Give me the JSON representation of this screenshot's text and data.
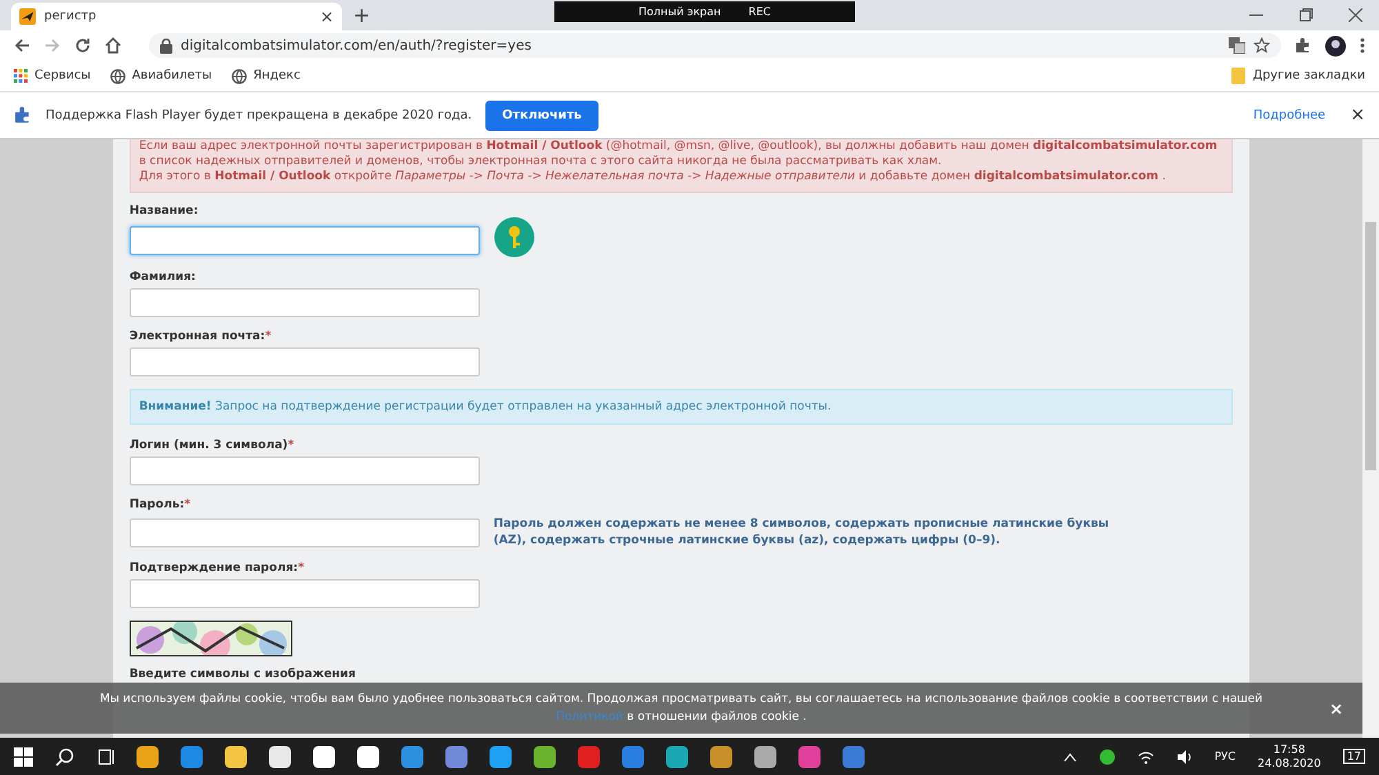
{
  "browser": {
    "tab": {
      "title": "регистр",
      "close": "×"
    },
    "new_tab": "+",
    "url": "digitalcombatsimulator.com/en/auth/?register=yes",
    "bookmarks": [
      {
        "label": "Сервисы",
        "kind": "apps"
      },
      {
        "label": "Авиабилеты",
        "kind": "globe"
      },
      {
        "label": "Яндекс",
        "kind": "globe"
      }
    ],
    "other_bookmarks": "Другие закладки"
  },
  "recorder": {
    "label": "Полный экран",
    "rec": "REC"
  },
  "infobar": {
    "text": "Поддержка Flash Player будет прекращена в декабре 2020 года.",
    "button": "Отключить",
    "link": "Подробнее",
    "close": "×"
  },
  "alert": {
    "lines": [
      "Если ваш адрес электронной почты зарегистрирован в **Hotmail / Outlook** (@hotmail, @msn, @live, @outlook), вы должны добавить наш домен **digitalcombatsimulator.com** в список надежных отправителей и доменов, чтобы электронная почта с этого сайта никогда не была рассматривать как хлам.",
      "Для этого в **Hotmail / Outlook** откройте *Параметры -> Почта -> Нежелательная почта -> Надежные отправители* и добавьте домен **digitalcombatsimulator.com** ."
    ]
  },
  "form": [
    {
      "kind": "field",
      "label": "Название:",
      "required": false,
      "focused": true,
      "hint_key": true
    },
    {
      "kind": "field",
      "label": "Фамилия:",
      "required": false,
      "focused": false
    },
    {
      "kind": "field",
      "label": "Электронная почта:",
      "required": true,
      "focused": false
    },
    {
      "kind": "notice",
      "text": "**Внимание!** Запрос на подтверждение регистрации будет отправлен на указанный адрес электронной почты."
    },
    {
      "kind": "field",
      "label": "Логин (мин. 3 символа)",
      "required": true,
      "focused": false
    },
    {
      "kind": "field",
      "label": "Пароль:",
      "required": true,
      "focused": false,
      "help": "Пароль должен содержать не менее 8 символов, содержать прописные латинские буквы (AZ), содержать строчные латинские буквы (az), содержать цифры (0–9)."
    },
    {
      "kind": "field",
      "label": "Подтверждение пароля:",
      "required": true,
      "focused": false
    },
    {
      "kind": "captcha"
    },
    {
      "kind": "caption",
      "label": "Введите символы с изображения"
    }
  ],
  "required_mark": "*",
  "cookie": {
    "text": "Мы используем файлы cookie, чтобы вам было удобнее пользоваться сайтом. Продолжая просматривать сайт, вы соглашаетесь на использование файлов cookie в соответствии с нашей",
    "link": "Политикой",
    "tail": "в отношении файлов cookie .",
    "close": "×"
  },
  "taskbar": {
    "apps": [
      {
        "color": "#e8a317"
      },
      {
        "color": "#1e88e5"
      },
      {
        "color": "#f4c542"
      },
      {
        "color": "#e8e8e8"
      },
      {
        "color": "#ffffff"
      },
      {
        "color": "#ffffff"
      },
      {
        "color": "#2d8fe0"
      },
      {
        "color": "#7289da"
      },
      {
        "color": "#1ea1f2"
      },
      {
        "color": "#6ab42d"
      },
      {
        "color": "#e02020"
      },
      {
        "color": "#2a7de1"
      },
      {
        "color": "#1ca7b5"
      },
      {
        "color": "#c8902a"
      },
      {
        "color": "#aaaaaa"
      },
      {
        "color": "#e0409a"
      },
      {
        "color": "#3a7bd5"
      }
    ],
    "lang": "РУС",
    "time": "17:58",
    "date": "24.08.2020",
    "notifications": "17"
  }
}
